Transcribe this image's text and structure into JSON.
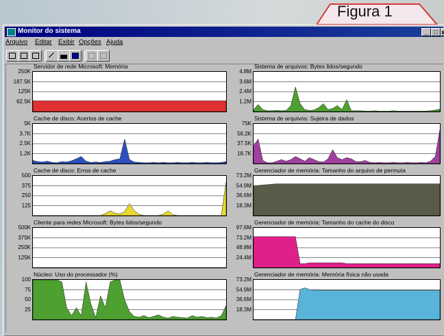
{
  "figure_label": "Figura 1",
  "window": {
    "title": "Monitor do sistema",
    "buttons": [
      "_",
      "□",
      "x"
    ]
  },
  "menu": [
    "Arquivo",
    "Editar",
    "Exibir",
    "Opções",
    "Ajuda"
  ],
  "toolbar": {
    "icons": [
      "new-icon",
      "copy-icon",
      "remove-icon",
      "area-chart-icon",
      "bar-chart-icon",
      "numeric-icon",
      "edit-icon",
      "delete-icon"
    ]
  },
  "panels": [
    {
      "title": "Servidor de rede Microsoft: Memória",
      "ticks": [
        "250K",
        "187.5K",
        "125K",
        "62.5K"
      ],
      "color": "#e03030",
      "values": [
        0.27,
        0.27,
        0.27,
        0.27,
        0.27,
        0.27,
        0.27,
        0.27,
        0.27,
        0.27,
        0.27,
        0.27,
        0.27,
        0.27,
        0.27,
        0.27,
        0.27,
        0.27,
        0.27,
        0.27,
        0.27,
        0.27,
        0.27,
        0.27,
        0.27,
        0.27,
        0.27,
        0.27,
        0.27,
        0.27,
        0.27,
        0.27,
        0.27,
        0.27,
        0.27,
        0.27,
        0.27,
        0.27,
        0.27,
        0.27,
        0.27
      ]
    },
    {
      "title": "Cache de disco: Acertos de cache",
      "ticks": [
        "5K",
        "3.7K",
        "2.5K",
        "1.2K"
      ],
      "color": "#2a50c0",
      "values": [
        0.08,
        0.05,
        0.04,
        0.06,
        0.03,
        0.02,
        0.05,
        0.04,
        0.07,
        0.12,
        0.18,
        0.06,
        0.03,
        0.04,
        0.03,
        0.05,
        0.06,
        0.1,
        0.12,
        0.62,
        0.1,
        0.04,
        0.03,
        0.02,
        0.02,
        0.03,
        0.02,
        0.03,
        0.02,
        0.02,
        0.03,
        0.02,
        0.02,
        0.03,
        0.02,
        0.02,
        0.03,
        0.02,
        0.02,
        0.03,
        0.05
      ]
    },
    {
      "title": "Cache de disco: Erros de cache",
      "ticks": [
        "500",
        "375",
        "250",
        "125"
      ],
      "color": "#e8d830",
      "values": [
        0,
        0,
        0,
        0,
        0,
        0,
        0,
        0,
        0,
        0,
        0,
        0,
        0,
        0,
        0,
        0.05,
        0.12,
        0.06,
        0.04,
        0.1,
        0.3,
        0.12,
        0.03,
        0,
        0,
        0,
        0,
        0.04,
        0.12,
        0.02,
        0,
        0,
        0,
        0,
        0,
        0,
        0,
        0,
        0,
        0,
        0.85
      ]
    },
    {
      "title": "Cliente para redes Microsoft: Bytes lidos/segundo",
      "ticks": [
        "500K",
        "375K",
        "250K",
        "125K"
      ],
      "color": "#2e8b40",
      "values": [
        0,
        0,
        0,
        0,
        0,
        0,
        0,
        0,
        0,
        0,
        0,
        0,
        0,
        0,
        0,
        0,
        0,
        0,
        0,
        0,
        0,
        0,
        0,
        0,
        0,
        0,
        0,
        0,
        0,
        0,
        0,
        0,
        0,
        0,
        0,
        0,
        0,
        0,
        0,
        0,
        0
      ]
    },
    {
      "title": "Núcleo: Uso do processador (%)",
      "ticks": [
        "100",
        "75",
        "50",
        "25"
      ],
      "color": "#4ea030",
      "values": [
        1,
        1,
        1,
        1,
        1,
        1,
        0.95,
        0.3,
        0.1,
        0.3,
        0.1,
        0.95,
        0.4,
        0.05,
        0.6,
        0.3,
        0.95,
        1,
        1,
        0.5,
        0.2,
        0.08,
        0.06,
        0.1,
        0.05,
        0.08,
        0.12,
        0.06,
        0.04,
        0.08,
        0.06,
        0.05,
        0.04,
        0.1,
        0.06,
        0.08,
        0.05,
        0.06,
        0.04,
        0.1,
        0.35
      ]
    },
    {
      "title": "Sistema de arquivos: Bytes lidos/segundo",
      "ticks": [
        "4.8M",
        "3.6M",
        "2.4M",
        "1.2M"
      ],
      "color": "#4ea030",
      "values": [
        0.05,
        0.18,
        0.05,
        0.02,
        0.02,
        0.03,
        0.02,
        0.03,
        0.15,
        0.62,
        0.2,
        0.05,
        0.03,
        0.04,
        0.1,
        0.2,
        0.05,
        0.08,
        0.15,
        0.05,
        0.3,
        0.02,
        0.02,
        0.02,
        0.01,
        0.01,
        0.02,
        0.01,
        0.01,
        0.01,
        0.02,
        0.01,
        0.01,
        0.01,
        0.01,
        0.01,
        0.01,
        0.01,
        0.02,
        0.04,
        0.06
      ]
    },
    {
      "title": "Sistema de arquivos: Sujeira de dados",
      "ticks": [
        "75K",
        "56.2K",
        "37.5K",
        "18.7K"
      ],
      "color": "#a040a0",
      "values": [
        0.45,
        0.62,
        0.08,
        0.02,
        0.02,
        0.06,
        0.1,
        0.06,
        0.1,
        0.18,
        0.12,
        0.06,
        0.15,
        0.1,
        0.05,
        0.04,
        0.12,
        0.35,
        0.15,
        0.1,
        0.15,
        0.12,
        0.05,
        0.05,
        0.08,
        0.03,
        0.02,
        0.03,
        0.02,
        0.02,
        0.03,
        0.02,
        0.02,
        0.03,
        0.02,
        0.02,
        0.03,
        0.02,
        0.06,
        0.18,
        0.85
      ]
    },
    {
      "title": "Gerenciador de memória: Tamanho do arquivo de permuta",
      "ticks": [
        "73.2M",
        "54.9M",
        "36.6M",
        "18.3M"
      ],
      "color": "#5a5a48",
      "values": [
        0.75,
        0.76,
        0.77,
        0.78,
        0.79,
        0.8,
        0.8,
        0.8,
        0.8,
        0.8,
        0.8,
        0.8,
        0.8,
        0.8,
        0.8,
        0.8,
        0.8,
        0.8,
        0.8,
        0.8,
        0.8,
        0.8,
        0.8,
        0.8,
        0.8,
        0.8,
        0.8,
        0.8,
        0.8,
        0.8,
        0.8,
        0.8,
        0.8,
        0.8,
        0.8,
        0.8,
        0.8,
        0.8,
        0.8,
        0.8,
        0.8
      ]
    },
    {
      "title": "Gerenciador de memória: Tamanho do cache do disco",
      "ticks": [
        "97.6M",
        "73.2M",
        "48.8M",
        "24.4M"
      ],
      "color": "#e0208a",
      "values": [
        0.78,
        0.78,
        0.78,
        0.78,
        0.78,
        0.78,
        0.78,
        0.78,
        0.78,
        0.78,
        0.1,
        0.1,
        0.12,
        0.12,
        0.12,
        0.12,
        0.12,
        0.12,
        0.12,
        0.12,
        0.1,
        0.1,
        0.1,
        0.1,
        0.1,
        0.1,
        0.1,
        0.1,
        0.1,
        0.1,
        0.1,
        0.1,
        0.1,
        0.1,
        0.1,
        0.1,
        0.1,
        0.1,
        0.1,
        0.1,
        0.1
      ]
    },
    {
      "title": "Gerenciador de memória: Memória física não usada",
      "ticks": [
        "73.2M",
        "54.9M",
        "36.6M",
        "18.3M"
      ],
      "color": "#58b4d8",
      "values": [
        0,
        0,
        0,
        0,
        0,
        0,
        0,
        0,
        0,
        0,
        0.76,
        0.8,
        0.76,
        0.74,
        0.74,
        0.74,
        0.74,
        0.74,
        0.74,
        0.74,
        0.74,
        0.74,
        0.74,
        0.74,
        0.74,
        0.74,
        0.74,
        0.74,
        0.74,
        0.74,
        0.74,
        0.74,
        0.74,
        0.74,
        0.74,
        0.74,
        0.74,
        0.74,
        0.74,
        0.74,
        0.74
      ]
    }
  ]
}
